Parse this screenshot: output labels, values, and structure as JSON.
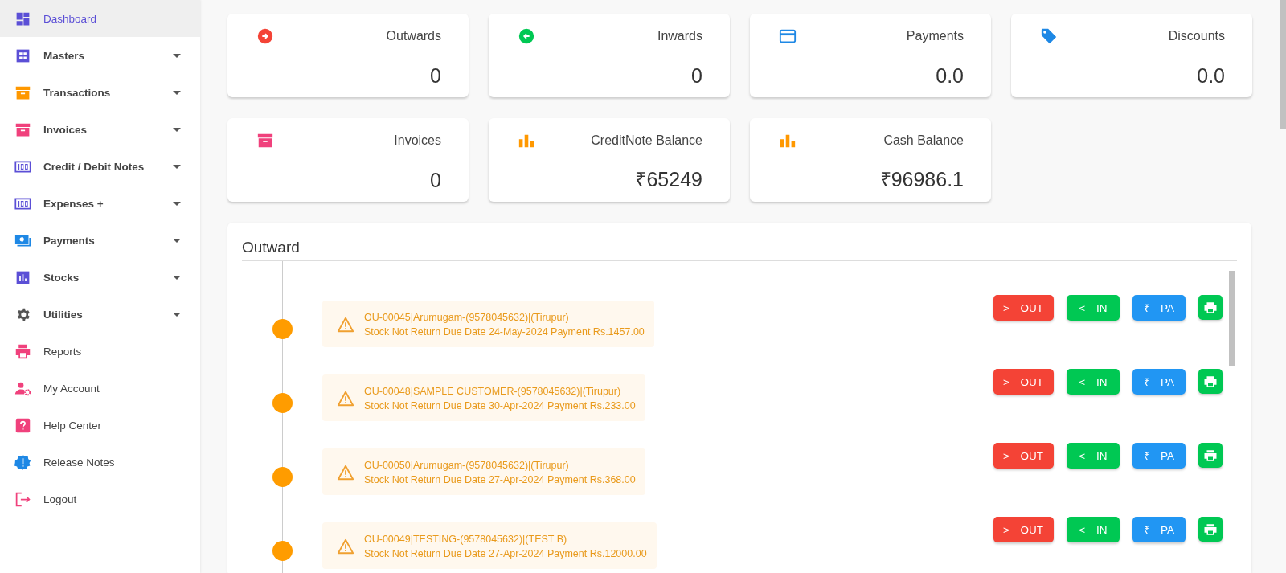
{
  "sidebar": {
    "items": [
      {
        "label": "Dashboard",
        "selected": true,
        "expandable": false
      },
      {
        "label": "Masters",
        "selected": false,
        "expandable": true
      },
      {
        "label": "Transactions",
        "selected": false,
        "expandable": true
      },
      {
        "label": "Invoices",
        "selected": false,
        "expandable": true
      },
      {
        "label": "Credit / Debit Notes",
        "selected": false,
        "expandable": true
      },
      {
        "label": "Expenses +",
        "selected": false,
        "expandable": true
      },
      {
        "label": "Payments",
        "selected": false,
        "expandable": true
      },
      {
        "label": "Stocks",
        "selected": false,
        "expandable": true
      },
      {
        "label": "Utilities",
        "selected": false,
        "expandable": true
      },
      {
        "label": "Reports",
        "selected": false,
        "expandable": false
      },
      {
        "label": "My Account",
        "selected": false,
        "expandable": false
      },
      {
        "label": "Help Center",
        "selected": false,
        "expandable": false
      },
      {
        "label": "Release Notes",
        "selected": false,
        "expandable": false
      },
      {
        "label": "Logout",
        "selected": false,
        "expandable": false
      }
    ]
  },
  "cards": [
    {
      "label": "Outwards",
      "value": "0"
    },
    {
      "label": "Inwards",
      "value": "0"
    },
    {
      "label": "Payments",
      "value": "0.0"
    },
    {
      "label": "Discounts",
      "value": "0.0"
    },
    {
      "label": "Invoices",
      "value": "0"
    },
    {
      "label": "CreditNote Balance",
      "value": "₹65249"
    },
    {
      "label": "Cash Balance",
      "value": "₹96986.1"
    }
  ],
  "outward": {
    "title": "Outward",
    "entries": [
      {
        "line1": "OU-00045|Arumugam-(9578045632)|(Tirupur)",
        "line2": "Stock Not Return Due Date 24-May-2024 Payment Rs.1457.00",
        "actions": [
          {
            "kind": "out",
            "glyph": ">",
            "label": "OUT"
          },
          {
            "kind": "in",
            "glyph": "<",
            "label": "IN"
          },
          {
            "kind": "pay",
            "glyph": "₹",
            "label": "PA"
          },
          {
            "kind": "print"
          }
        ]
      },
      {
        "line1": "OU-00048|SAMPLE CUSTOMER-(9578045632)|(Tirupur)",
        "line2": "Stock Not Return Due Date 30-Apr-2024 Payment Rs.233.00",
        "actions": [
          {
            "kind": "out",
            "glyph": ">",
            "label": "OUT"
          },
          {
            "kind": "in",
            "glyph": "<",
            "label": "IN"
          },
          {
            "kind": "pay",
            "glyph": "₹",
            "label": "PA"
          },
          {
            "kind": "print"
          }
        ]
      },
      {
        "line1": "OU-00050|Arumugam-(9578045632)|(Tirupur)",
        "line2": "Stock Not Return Due Date 27-Apr-2024 Payment Rs.368.00",
        "actions": [
          {
            "kind": "out",
            "glyph": ">",
            "label": "OUT"
          },
          {
            "kind": "in",
            "glyph": "<",
            "label": "IN"
          },
          {
            "kind": "pay",
            "glyph": "₹",
            "label": "PA"
          },
          {
            "kind": "print"
          }
        ]
      },
      {
        "line1": "OU-00049|TESTING-(9578045632)|(TEST B)",
        "line2": "Stock Not Return Due Date 27-Apr-2024 Payment Rs.12000.00",
        "actions": [
          {
            "kind": "out",
            "glyph": ">",
            "label": "OUT"
          },
          {
            "kind": "in",
            "glyph": "<",
            "label": "IN"
          },
          {
            "kind": "pay",
            "glyph": "₹",
            "label": "PA"
          },
          {
            "kind": "print"
          }
        ]
      }
    ]
  }
}
